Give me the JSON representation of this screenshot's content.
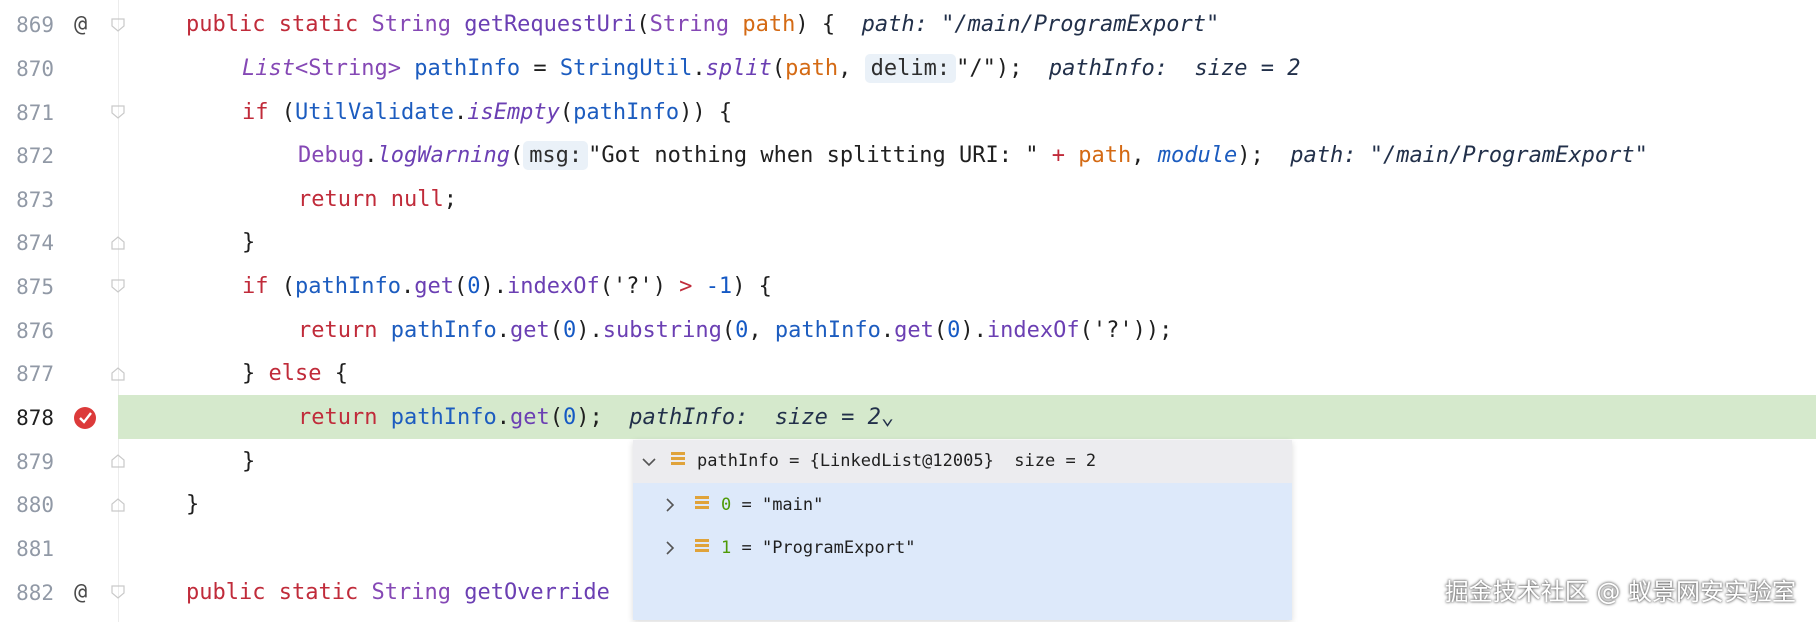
{
  "editor": {
    "lines": [
      {
        "num": "869",
        "gutter": "@"
      },
      {
        "num": "870",
        "gutter": ""
      },
      {
        "num": "871",
        "gutter": ""
      },
      {
        "num": "872",
        "gutter": ""
      },
      {
        "num": "873",
        "gutter": ""
      },
      {
        "num": "874",
        "gutter": ""
      },
      {
        "num": "875",
        "gutter": ""
      },
      {
        "num": "876",
        "gutter": ""
      },
      {
        "num": "877",
        "gutter": ""
      },
      {
        "num": "878",
        "gutter": ""
      },
      {
        "num": "879",
        "gutter": ""
      },
      {
        "num": "880",
        "gutter": ""
      },
      {
        "num": "881",
        "gutter": ""
      },
      {
        "num": "882",
        "gutter": "@"
      }
    ],
    "code": {
      "l869": {
        "kw1": "public",
        "kw2": "static",
        "type": "String",
        "method": "getRequestUri",
        "p1": "(",
        "ptype": "String",
        "param": "path",
        "p2": ") {",
        "hint": "path: \"/main/ProgramExport\""
      },
      "l870": {
        "type": "List",
        "generic": "<String>",
        "var": "pathInfo",
        "eq": " = ",
        "cls": "StringUtil",
        "dot": ".",
        "method": "split",
        "open": "(",
        "arg": "path",
        "comma": ", ",
        "inlay": "delim:",
        "str": "\"/\"",
        "close": ");",
        "hint": "pathInfo:  size = 2"
      },
      "l871": {
        "kw": "if",
        "open": " (",
        "cls": "UtilValidate",
        "dot": ".",
        "method": "isEmpty",
        "open2": "(",
        "var": "pathInfo",
        "close": ")) {"
      },
      "l872": {
        "cls": "Debug",
        "dot": ".",
        "method": "logWarning",
        "open": "(",
        "inlay": "msg:",
        "str": "\"Got nothing when splitting URI: \"",
        "plus": " + ",
        "arg": "path",
        "comma": ", ",
        "field": "module",
        "close": ");",
        "hint": "path: \"/main/ProgramExport\""
      },
      "l873": {
        "kw": "return",
        "kw2": "null",
        "semi": ";"
      },
      "l874": {
        "brace": "}"
      },
      "l875": {
        "kw": "if",
        "open": " (",
        "var": "pathInfo",
        "dot": ".",
        "m1": "get",
        "o1": "(",
        "n1": "0",
        "c1": ").",
        "m2": "indexOf",
        "o2": "(",
        "ch": "'?'",
        "c2": ")",
        "gt": " > ",
        "n2": "-1",
        "close": ") {"
      },
      "l876": {
        "kw": "return",
        "var": "pathInfo",
        "dot": ".",
        "m1": "get",
        "o1": "(",
        "n1": "0",
        "c1": ").",
        "m2": "substring",
        "o2": "(",
        "n2": "0",
        "comma": ", ",
        "var2": "pathInfo",
        "dot2": ".",
        "m3": "get",
        "o3": "(",
        "n3": "0",
        "c3": ").",
        "m4": "indexOf",
        "o4": "(",
        "ch": "'?'",
        "close": "));"
      },
      "l877": {
        "brace": "}",
        "kw": "else",
        "open": " {"
      },
      "l878": {
        "kw": "return",
        "var": "pathInfo",
        "dot": ".",
        "m1": "get",
        "o1": "(",
        "n1": "0",
        "close": ");",
        "hint": "pathInfo:  size = 2",
        "chevron": "⌄"
      },
      "l879": {
        "brace": "}"
      },
      "l880": {
        "brace": "}"
      },
      "l882": {
        "kw1": "public",
        "kw2": "static",
        "type": "String",
        "method": "getOverride"
      }
    }
  },
  "debug_popup": {
    "header": "pathInfo = {LinkedList@12005}  size = 2",
    "items": [
      {
        "index": "0",
        "value": " = \"main\""
      },
      {
        "index": "1",
        "value": " = \"ProgramExport\""
      }
    ]
  },
  "watermark": "掘金技术社区 @ 蚁景网安实验室"
}
